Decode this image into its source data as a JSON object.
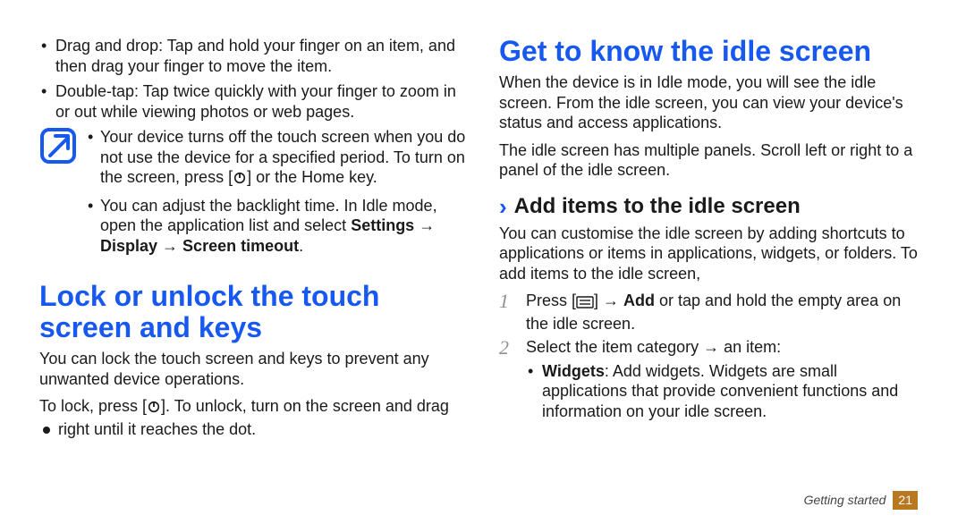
{
  "left": {
    "bullets": [
      "Drag and drop: Tap and hold your finger on an item, and then drag your finger to move the item.",
      "Double-tap: Tap twice quickly with your finger to zoom in or out while viewing photos or web pages."
    ],
    "note": {
      "b1_pre": "Your device turns off the touch screen when you do not use the device for a specified period. To turn on the screen, press [",
      "b1_post": "] or the Home key.",
      "b2_pre": "You can adjust the backlight time. In Idle mode, open the application list and select ",
      "b2_boldA": "Settings",
      "b2_arrow1": " → ",
      "b2_boldB": "Display",
      "b2_arrow2": " → ",
      "b2_boldC": "Screen timeout",
      "b2_end": "."
    },
    "h2": "Lock or unlock the touch screen and keys",
    "p1": "You can lock the touch screen and keys to prevent any unwanted device operations.",
    "p2_pre": "To lock, press [",
    "p2_mid": "]. To unlock, turn on the screen and drag ",
    "p2_post": " right until it reaches the dot."
  },
  "right": {
    "h2a": "Get to know the idle screen",
    "pA": "When the device is in Idle mode, you will see the idle screen. From the idle screen, you can view your device's status and access applications.",
    "pB": "The idle screen has multiple panels. Scroll left or right to a panel of the idle screen.",
    "h3": "Add items to the idle screen",
    "pC": "You can customise the idle screen by adding shortcuts to applications or items in applications, widgets, or folders. To add items to the idle screen,",
    "step1_pre": "Press [",
    "step1_arrow": "] → ",
    "step1_bold": "Add",
    "step1_post": " or tap and hold the empty area on the idle screen.",
    "step2": "Select the item category → an item:",
    "step2_b_bold": "Widgets",
    "step2_b_rest": ": Add widgets. Widgets are small applications that provide convenient functions and information on your idle screen."
  },
  "footer": {
    "section": "Getting started",
    "page": "21"
  },
  "icons": {
    "note": "note-icon",
    "power": "power-icon",
    "menu": "menu-icon",
    "drag_dot": "drag-handle-icon",
    "chevron": "›"
  }
}
